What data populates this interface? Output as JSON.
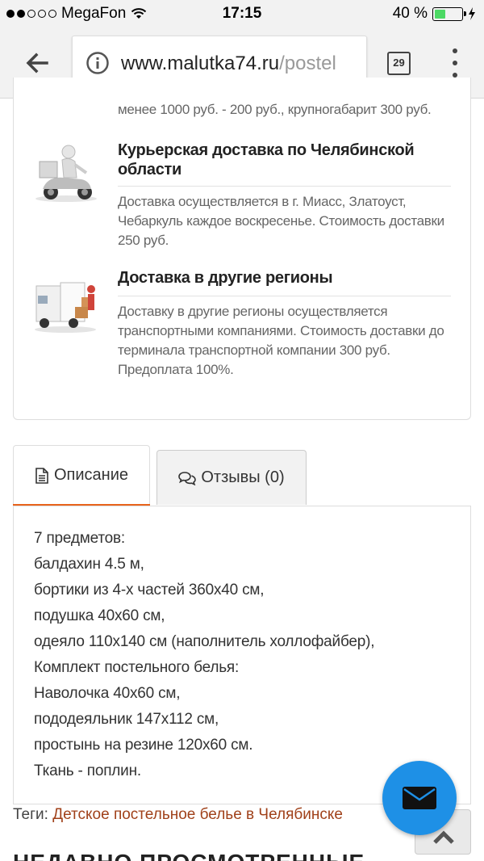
{
  "status_bar": {
    "carrier": "MegaFon",
    "time": "17:15",
    "battery": "40 %",
    "battery_level": 0.4
  },
  "browser": {
    "url_host": "www.malutka74.ru",
    "url_path": "/postel",
    "tab_count": "29"
  },
  "delivery": {
    "partial_text": "менее 1000 руб. - 200 руб., крупногабарит 300 руб.",
    "items": [
      {
        "title": "Курьерская доставка по Челябинской области",
        "text": "Доставка осуществляется в г. Миасс, Златоуст, Чебаркуль каждое воскресенье. Стоимость доставки 250 руб."
      },
      {
        "title": "Доставка в другие регионы",
        "text": "Доставку в другие регионы осуществляется транспортными компаниями. Стоимость доставки до терминала транспортной компании 300 руб. Предоплата 100%."
      }
    ]
  },
  "tabs": {
    "description": "Описание",
    "reviews": "Отзывы (0)"
  },
  "description_lines": [
    "7 предметов:",
    "балдахин 4.5 м,",
    "бортики из 4-х частей 360х40 см,",
    "подушка 40х60 см,",
    "одеяло 110х140 см (наполнитель холлофайбер),",
    "Комплект постельного белья:",
    "Наволочка 40х60 см,",
    "пододеяльник 147х112 см,",
    "простынь на резине 120х60 см.",
    "Ткань - поплин."
  ],
  "tags": {
    "label": "Теги:",
    "link": "Детское постельное белье в Челябинске"
  },
  "next_heading": "НЕДАВНО ПРОСМОТРЕННЫЕ",
  "colors": {
    "accent": "#e8631c",
    "fab": "#1e90e6",
    "tag_link": "#a0411a"
  }
}
